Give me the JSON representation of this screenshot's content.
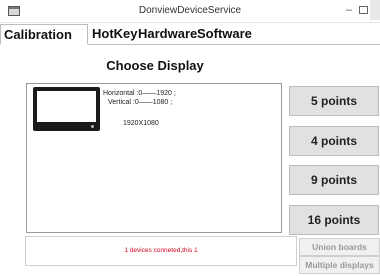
{
  "window": {
    "title": "DonviewDeviceService",
    "minimize_glyph": "–"
  },
  "tabs": [
    {
      "label": "Calibration",
      "active": true
    },
    {
      "label": "HotKey",
      "active": false
    },
    {
      "label": "Hardware",
      "active": false
    },
    {
      "label": "Software",
      "active": false
    }
  ],
  "calibration": {
    "heading": "Choose Display",
    "display": {
      "horizontal": "Horizontal :0——1920 ;",
      "vertical": "Vertical :0——1080 ;",
      "resolution": "1920X1080"
    },
    "point_buttons": [
      "5 points",
      "4 points",
      "9 points",
      "16 points"
    ],
    "status": "1 devices conneted,this 1",
    "union_boards": "Union boards",
    "multiple_displays": "Multiple displays"
  },
  "colors": {
    "status_text": "#d0021b",
    "button_bg": "#e1e1e1",
    "disabled_text": "#999999"
  },
  "icons": {
    "app": "app-window-icon",
    "monitor": "monitor-icon"
  }
}
